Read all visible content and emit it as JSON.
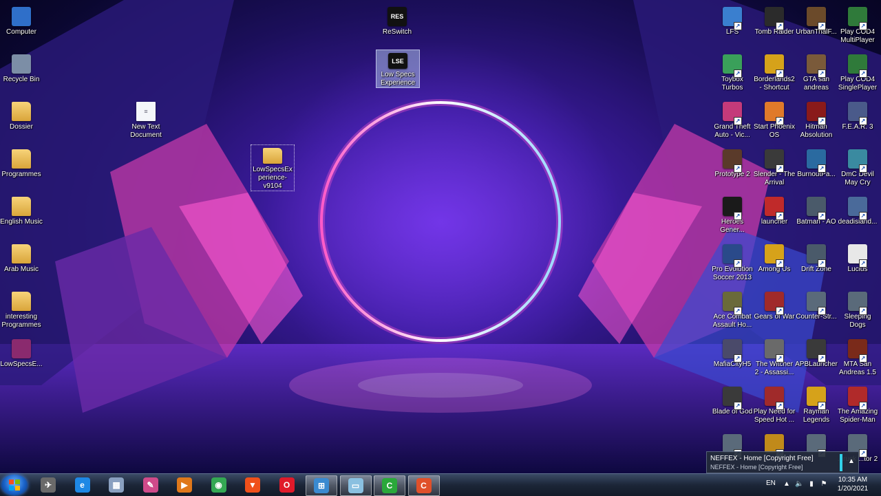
{
  "desktop": {
    "left_icons": [
      {
        "label": "Computer",
        "icon": "computer-icon",
        "color": "#2f6fc9"
      },
      {
        "label": "Recycle Bin",
        "icon": "recycle-bin-icon",
        "color": "#7c8ea6"
      },
      {
        "label": "Dossier",
        "icon": "folder-icon",
        "color": "#e8bd55"
      },
      {
        "label": "Programmes",
        "icon": "folder-icon",
        "color": "#e8bd55"
      },
      {
        "label": "English Music",
        "icon": "folder-icon",
        "color": "#e8bd55"
      },
      {
        "label": "Arab Music",
        "icon": "folder-icon",
        "color": "#e8bd55"
      },
      {
        "label": "interesting Programmes",
        "icon": "folder-icon",
        "color": "#e8bd55"
      },
      {
        "label": "LowSpecsE...",
        "icon": "winrar-archive-icon",
        "color": "#8a2a6e"
      }
    ],
    "middle_icons": {
      "new_text_document": "New Text Document",
      "folder_lowspecs": "LowSpecsExperience-v9104",
      "reswitch": "ReSwitch",
      "reswitch_glyph": "RES",
      "low_specs_experience": "Low Specs Experience",
      "low_specs_glyph": "LSE"
    },
    "right_icons": [
      {
        "label": "LFS",
        "color": "#3a7fcf"
      },
      {
        "label": "Tomb Raider",
        "color": "#2b2b2b"
      },
      {
        "label": "UrbanTrialF...",
        "color": "#6b4a2a"
      },
      {
        "label": "Play COD4 MultiPlayer",
        "color": "#2f7a3a"
      },
      {
        "label": "Toybox Turbos",
        "color": "#3aa05a"
      },
      {
        "label": "Borderlands2 - Shortcut",
        "color": "#d6a21a"
      },
      {
        "label": "GTA san andreas",
        "color": "#7a5a3a"
      },
      {
        "label": "Play COD4 SinglePlayer",
        "color": "#2f7a3a"
      },
      {
        "label": "Grand Theft Auto - Vic...",
        "color": "#c43a7a"
      },
      {
        "label": "Start Phoenix OS",
        "color": "#e07a2a"
      },
      {
        "label": "Hitman Absolution",
        "color": "#8a1a1a"
      },
      {
        "label": "F.E.A.R. 3",
        "color": "#4a5a8a"
      },
      {
        "label": "Prototype 2",
        "color": "#5a3a2a"
      },
      {
        "label": "Slender - The Arrival",
        "color": "#3a3a3a"
      },
      {
        "label": "BurnoutPa...",
        "color": "#2a6aa0"
      },
      {
        "label": "DmC Devil May Cry",
        "color": "#3a8aa0"
      },
      {
        "label": "Heroes Gener...",
        "color": "#1a1a1a"
      },
      {
        "label": "launcher",
        "color": "#c02a2a"
      },
      {
        "label": "Batman - AO",
        "color": "#4a5a6a"
      },
      {
        "label": "deadisland...",
        "color": "#4a6a9a"
      },
      {
        "label": "Pro Evolution Soccer 2013",
        "color": "#2a4a8a"
      },
      {
        "label": "Among Us",
        "color": "#d6a21a"
      },
      {
        "label": "Drift Zone",
        "color": "#4a5a6a"
      },
      {
        "label": "Lucius",
        "color": "#e8e8e8"
      },
      {
        "label": "Ace Combat Assault Ho...",
        "color": "#6a6a3a"
      },
      {
        "label": "Gears of War",
        "color": "#a02a2a"
      },
      {
        "label": "Counter-Str...",
        "color": "#5a6a7a"
      },
      {
        "label": "Sleeping Dogs",
        "color": "#5a6a7a"
      },
      {
        "label": "MafiaCityH5",
        "color": "#4a4a6a"
      },
      {
        "label": "The Witcher 2 - Assassi...",
        "color": "#6a6a6a"
      },
      {
        "label": "APBLauncher",
        "color": "#3a3a3a"
      },
      {
        "label": "MTA San Andreas 1.5",
        "color": "#7a2a1a"
      },
      {
        "label": "Blade of God",
        "color": "#3a3a3a"
      },
      {
        "label": "Play Need for Speed Hot ...",
        "color": "#a02a2a"
      },
      {
        "label": "Rayman Legends",
        "color": "#d6a21a"
      },
      {
        "label": "The Amazing Spider-Man",
        "color": "#b02a2a"
      },
      {
        "label": "",
        "color": "#5a6a7a"
      },
      {
        "label": "",
        "color": "#c08a1a"
      },
      {
        "label": "",
        "color": "#5a6a7a"
      },
      {
        "label": "...ruck ...tor 2",
        "color": "#5a6a7a"
      }
    ]
  },
  "taskbar": {
    "pinned": [
      {
        "name": "file-explorer-icon",
        "glyph": "✈",
        "color": "#6a6a6a"
      },
      {
        "name": "internet-explorer-icon",
        "glyph": "e",
        "color": "#1e88e5"
      },
      {
        "name": "calculator-icon",
        "glyph": "▦",
        "color": "#8aa0c0"
      },
      {
        "name": "paint-icon",
        "glyph": "✎",
        "color": "#d04a8a"
      },
      {
        "name": "media-player-icon",
        "glyph": "▶",
        "color": "#e0781a"
      },
      {
        "name": "chrome-icon",
        "glyph": "◉",
        "color": "#34a853"
      },
      {
        "name": "brave-icon",
        "glyph": "▼",
        "color": "#f0501a"
      },
      {
        "name": "opera-icon",
        "glyph": "O",
        "color": "#e01a2a"
      },
      {
        "name": "control-panel-icon",
        "glyph": "⊞",
        "color": "#3a8ad0"
      },
      {
        "name": "desktop-window-icon",
        "glyph": "▭",
        "color": "#8ac0e0"
      },
      {
        "name": "camtasia-green-icon",
        "glyph": "C",
        "color": "#2aa83a"
      },
      {
        "name": "camtasia-orange-icon",
        "glyph": "C",
        "color": "#e0502a"
      }
    ],
    "language": "EN",
    "time": "10:35 AM",
    "date": "1/20/2021"
  },
  "media_popup": {
    "title": "NEFFEX - Home  [Copyright Free]",
    "subtitle": "NEFFEX - Home  [Copyright Free]",
    "accent": "#32d1e8"
  }
}
